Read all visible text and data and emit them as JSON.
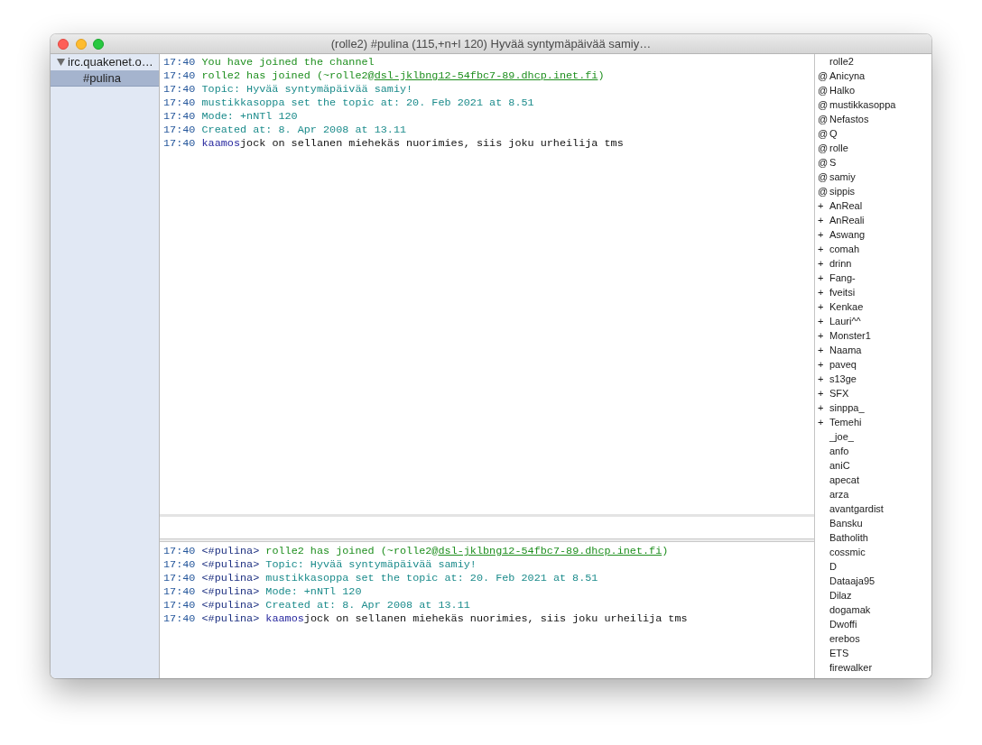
{
  "window": {
    "title": "(rolle2) #pulina (115,+n+l 120) Hyvää syntymäpäivää samiy…"
  },
  "sidebar": {
    "items": [
      {
        "label": "irc.quakenet.o…",
        "expanded": true,
        "selected": false,
        "children": [
          {
            "label": "#pulina",
            "selected": true
          }
        ]
      }
    ]
  },
  "channel_log": {
    "lines": [
      {
        "time": "17:40",
        "kind": "join",
        "text": "You have joined the channel"
      },
      {
        "time": "17:40",
        "kind": "join",
        "text": "rolle2 has joined (~rolle2@",
        "link": "dsl-jklbng12-54fbc7-89.dhcp.inet.fi",
        "text_after": ")"
      },
      {
        "time": "17:40",
        "kind": "info",
        "text": "Topic: Hyvää syntymäpäivää samiy!"
      },
      {
        "time": "17:40",
        "kind": "info",
        "text": "mustikkasoppa set the topic at: 20. Feb 2021 at 8.51"
      },
      {
        "time": "17:40",
        "kind": "info",
        "text": "Mode: +nNTl 120"
      },
      {
        "time": "17:40",
        "kind": "info",
        "text": "Created at: 8. Apr 2008 at 13.11"
      },
      {
        "time": "17:40",
        "kind": "message",
        "nick": "kaamos",
        "text": "jock on sellanen miehekäs nuorimies, siis joku urheilija tms"
      }
    ]
  },
  "highlights_log": {
    "lines": [
      {
        "time": "17:40",
        "channel": "<#pulina>",
        "kind": "join",
        "text": "rolle2 has joined (~rolle2@",
        "link": "dsl-jklbng12-54fbc7-89.dhcp.inet.fi",
        "text_after": ")"
      },
      {
        "time": "17:40",
        "channel": "<#pulina>",
        "kind": "info",
        "text": "Topic: Hyvää syntymäpäivää samiy!"
      },
      {
        "time": "17:40",
        "channel": "<#pulina>",
        "kind": "info",
        "text": "mustikkasoppa set the topic at: 20. Feb 2021 at 8.51"
      },
      {
        "time": "17:40",
        "channel": "<#pulina>",
        "kind": "info",
        "text": "Mode: +nNTl 120"
      },
      {
        "time": "17:40",
        "channel": "<#pulina>",
        "kind": "info",
        "text": "Created at: 8. Apr 2008 at 13.11"
      },
      {
        "time": "17:40",
        "channel": "<#pulina>",
        "kind": "message",
        "nick": "kaamos",
        "text": "jock on sellanen miehekäs nuorimies, siis joku urheilija tms"
      }
    ]
  },
  "nick_list": {
    "items": [
      {
        "nick": "rolle2"
      },
      {
        "prefix": "@",
        "nick": "Anicyna"
      },
      {
        "prefix": "@",
        "nick": "Halko"
      },
      {
        "prefix": "@",
        "nick": "mustikkasoppa"
      },
      {
        "prefix": "@",
        "nick": "Nefastos"
      },
      {
        "prefix": "@",
        "nick": "Q"
      },
      {
        "prefix": "@",
        "nick": "rolle"
      },
      {
        "prefix": "@",
        "nick": "S"
      },
      {
        "prefix": "@",
        "nick": "samiy"
      },
      {
        "prefix": "@",
        "nick": "sippis"
      },
      {
        "prefix": "+",
        "nick": "AnReal"
      },
      {
        "prefix": "+",
        "nick": "AnReali"
      },
      {
        "prefix": "+",
        "nick": "Aswang"
      },
      {
        "prefix": "+",
        "nick": "comah"
      },
      {
        "prefix": "+",
        "nick": "drinn"
      },
      {
        "prefix": "+",
        "nick": "Fang-"
      },
      {
        "prefix": "+",
        "nick": "fveitsi"
      },
      {
        "prefix": "+",
        "nick": "Kenkae"
      },
      {
        "prefix": "+",
        "nick": "Lauri^^"
      },
      {
        "prefix": "+",
        "nick": "Monster1"
      },
      {
        "prefix": "+",
        "nick": "Naama"
      },
      {
        "prefix": "+",
        "nick": "paveq"
      },
      {
        "prefix": "+",
        "nick": "s13ge"
      },
      {
        "prefix": "+",
        "nick": "SFX"
      },
      {
        "prefix": "+",
        "nick": "sinppa_"
      },
      {
        "prefix": "+",
        "nick": "Temehi"
      },
      {
        "nick": "_joe_"
      },
      {
        "nick": "anfo"
      },
      {
        "nick": "aniC"
      },
      {
        "nick": "apecat"
      },
      {
        "nick": "arza"
      },
      {
        "nick": "avantgardist"
      },
      {
        "nick": "Bansku"
      },
      {
        "nick": "Batholith"
      },
      {
        "nick": "cossmic"
      },
      {
        "nick": "D"
      },
      {
        "nick": "Dataaja95"
      },
      {
        "nick": "Dilaz"
      },
      {
        "nick": "dogamak"
      },
      {
        "nick": "Dwoffi"
      },
      {
        "nick": "erebos"
      },
      {
        "nick": "ETS"
      },
      {
        "nick": "firewalker"
      }
    ]
  }
}
